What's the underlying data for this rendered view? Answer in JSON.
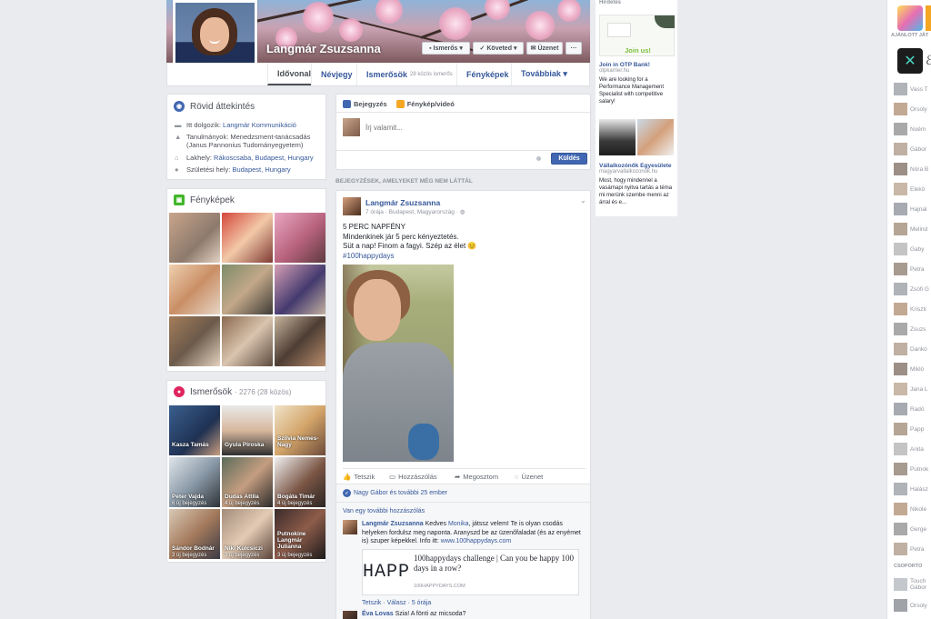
{
  "profile": {
    "name": "Langmár Zsuzsanna",
    "buttons": {
      "friends": "Ismerős",
      "follow": "Követed",
      "message": "Üzenet",
      "more": "···"
    },
    "tabs": [
      {
        "label": "Idővonal"
      },
      {
        "label": "Névjegy"
      },
      {
        "label": "Ismerősök",
        "count": "28 közös ismerős"
      },
      {
        "label": "Fényképek"
      },
      {
        "label": "Továbbiak ▾"
      }
    ]
  },
  "overview": {
    "title": "Rövid áttekintés",
    "work_label": "Itt dolgozik:",
    "work_link": "Langmár Kommunikáció",
    "study_label": "Tanulmányok:",
    "study_value": "Menedzsment-tanácsadás",
    "study_school": "(Janus Pannonius Tudományegyetem)",
    "lives_label": "Lakhely:",
    "lives_link": "Rákoscsaba, Budapest, Hungary",
    "born_label": "Születési hely:",
    "born_link": "Budapest, Hungary"
  },
  "photos": {
    "title": "Fényképek"
  },
  "friends": {
    "title": "Ismerősök",
    "count": "· 2276 (28 közös)",
    "items": [
      {
        "name": "Kasza Tamás",
        "sub": ""
      },
      {
        "name": "Gyula Piroska",
        "sub": ""
      },
      {
        "name": "Szilvia Nemes-Nagy",
        "sub": ""
      },
      {
        "name": "Péter Vajda",
        "sub": "6 új bejegyzés"
      },
      {
        "name": "Dudás Attila",
        "sub": "4 új bejegyzés"
      },
      {
        "name": "Bogáta Timár",
        "sub": "4 új bejegyzés"
      },
      {
        "name": "Sándor Bodnár",
        "sub": "3 új bejegyzés"
      },
      {
        "name": "Niki Kulcsiczi",
        "sub": "3 új bejegyzés"
      },
      {
        "name": "Putnokine Langmár Julianna",
        "sub": "3 új bejegyzés"
      }
    ]
  },
  "composer": {
    "tab_post": "Bejegyzés",
    "tab_photo": "Fénykép/videó",
    "placeholder": "Írj valamit...",
    "send": "Küldés"
  },
  "feed": {
    "section_label": "BEJEGYZÉSEK, AMELYEKET MÉG NEM LÁTTÁL",
    "post": {
      "author": "Langmár Zsuzsanna",
      "meta": "7 órája · Budapest, Magyarország · ",
      "line1": "5 PERC NAPFÉNY",
      "line2": "Mindenkinek jár 5 perc kényeztetés.",
      "line3": "Süt a nap! Finom a fagyi. Szép az élet 😊",
      "hashtag": "#100happydays",
      "actions": {
        "like": "Tetszik",
        "comment": "Hozzászólás",
        "share": "Megosztom",
        "message": "Üzenet"
      },
      "likes": "Nagy Gábor és további 25 ember",
      "more_comments": "Van egy további hozzászólás",
      "comment": {
        "author": "Langmár Zsuzsanna",
        "text1": " Kedves ",
        "mention": "Monika",
        "text2": ", játssz velem! Te is olyan csodás helyeken fordulsz meg naponta. Aranyszd be az üzenőfaladat (és az enyémet is) szuper képekkel. Info itt: ",
        "url": "www.100happydays.com",
        "link_title": "100happydays challenge | Can you be happy 100 days in a row?",
        "link_domain": "100HAPPYDAYS.COM",
        "link_image_text": "HAPPY",
        "actions": "Tetszik · Válasz · 5 órája"
      },
      "comment2_author": "Éva Lovas",
      "comment2_text": " Szia! A fönti az micsoda?"
    }
  },
  "ads": {
    "title": "Hirdetés",
    "ad1": {
      "image_text": "Join us!",
      "title": "Join in OTP Bank!",
      "domain": "otpkarrier.hu",
      "body": "We are looking for a Performance Management Specialist with competitive salary!"
    },
    "ad2": {
      "title": "Vállalkozónők Egyesülete",
      "domain": "magyarvallalkozonok.hu",
      "body": "Most, hogy mindennel a vasárnapi nyitva tartás a téma mi merünk szembe menni az árral és e..."
    }
  },
  "sidebar": {
    "recommended": "AJÁNLOTT JÁT",
    "contacts": [
      "Vass T",
      "Orsoly",
      "Noém",
      "Gábor",
      "Nóra B",
      "Elekö",
      "Hajnal",
      "Melind",
      "Gaby",
      "Petra",
      "Zsófi G",
      "Kriszti",
      "Zsuzs",
      "Dankó",
      "Mikló",
      "Jana L",
      "Radó",
      "Papp",
      "Anita",
      "Putnok",
      "Halász",
      "Nikole",
      "Gerge",
      "Petra"
    ],
    "group_label": "CSOPORTO",
    "group1": "Touch",
    "group1_sub": "Gábor",
    "last": "Orsoly"
  }
}
